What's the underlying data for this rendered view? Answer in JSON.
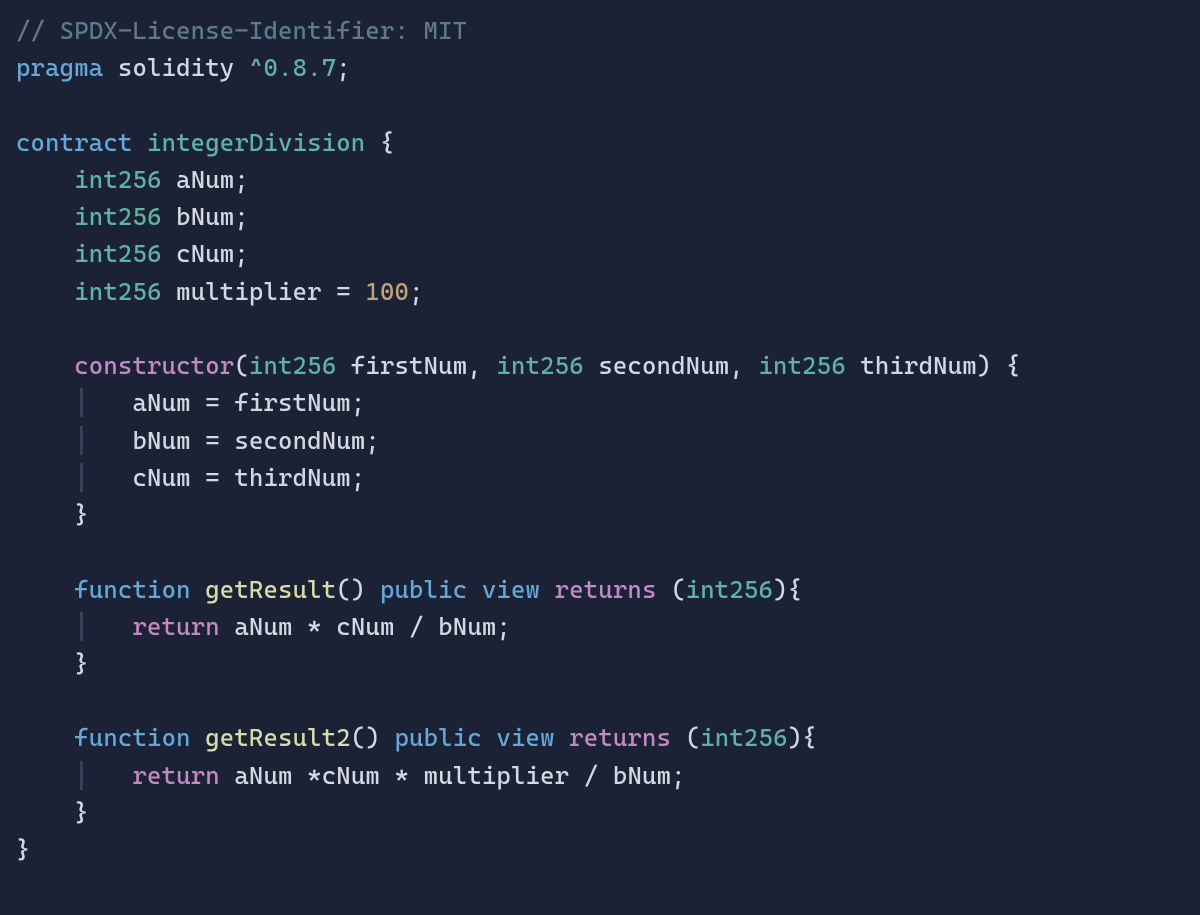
{
  "colors": {
    "background": "#1b2235",
    "comment": "#5f7a8c",
    "keyword_blue": "#64a7d8",
    "keyword_purple": "#c389c5",
    "type_teal": "#5fb3a1",
    "identifier": "#d3d8e0",
    "function_name": "#d7dba8",
    "number": "#bfa27a",
    "indent_guide": "#3a4763"
  },
  "code_lines": [
    {
      "indent": 0,
      "tokens": [
        {
          "t": "// SPDX-License-Identifier: MIT",
          "c": "comment"
        }
      ]
    },
    {
      "indent": 0,
      "tokens": [
        {
          "t": "pragma",
          "c": "keyword"
        },
        {
          "t": " ",
          "c": "punct"
        },
        {
          "t": "solidity",
          "c": "ident"
        },
        {
          "t": " ",
          "c": "punct"
        },
        {
          "t": "^0.8.7",
          "c": "type"
        },
        {
          "t": ";",
          "c": "punct"
        }
      ]
    },
    {
      "indent": 0,
      "tokens": []
    },
    {
      "indent": 0,
      "tokens": [
        {
          "t": "contract",
          "c": "keyword"
        },
        {
          "t": " ",
          "c": "punct"
        },
        {
          "t": "integerDivision",
          "c": "type"
        },
        {
          "t": " ",
          "c": "punct"
        },
        {
          "t": "{",
          "c": "punct"
        }
      ]
    },
    {
      "indent": 1,
      "tokens": [
        {
          "t": "int256",
          "c": "type"
        },
        {
          "t": " ",
          "c": "punct"
        },
        {
          "t": "aNum",
          "c": "ident"
        },
        {
          "t": ";",
          "c": "punct"
        }
      ]
    },
    {
      "indent": 1,
      "tokens": [
        {
          "t": "int256",
          "c": "type"
        },
        {
          "t": " ",
          "c": "punct"
        },
        {
          "t": "bNum",
          "c": "ident"
        },
        {
          "t": ";",
          "c": "punct"
        }
      ]
    },
    {
      "indent": 1,
      "tokens": [
        {
          "t": "int256",
          "c": "type"
        },
        {
          "t": " ",
          "c": "punct"
        },
        {
          "t": "cNum",
          "c": "ident"
        },
        {
          "t": ";",
          "c": "punct"
        }
      ]
    },
    {
      "indent": 1,
      "tokens": [
        {
          "t": "int256",
          "c": "type"
        },
        {
          "t": " ",
          "c": "punct"
        },
        {
          "t": "multiplier",
          "c": "ident"
        },
        {
          "t": " ",
          "c": "punct"
        },
        {
          "t": "=",
          "c": "punct"
        },
        {
          "t": " ",
          "c": "punct"
        },
        {
          "t": "100",
          "c": "num"
        },
        {
          "t": ";",
          "c": "punct"
        }
      ]
    },
    {
      "indent": 0,
      "tokens": []
    },
    {
      "indent": 1,
      "tokens": [
        {
          "t": "constructor",
          "c": "ctor"
        },
        {
          "t": "(",
          "c": "punct"
        },
        {
          "t": "int256",
          "c": "type"
        },
        {
          "t": " ",
          "c": "punct"
        },
        {
          "t": "firstNum",
          "c": "ident"
        },
        {
          "t": ",",
          "c": "punct"
        },
        {
          "t": " ",
          "c": "punct"
        },
        {
          "t": "int256",
          "c": "type"
        },
        {
          "t": " ",
          "c": "punct"
        },
        {
          "t": "secondNum",
          "c": "ident"
        },
        {
          "t": ",",
          "c": "punct"
        },
        {
          "t": " ",
          "c": "punct"
        },
        {
          "t": "int256",
          "c": "type"
        },
        {
          "t": " ",
          "c": "punct"
        },
        {
          "t": "thirdNum",
          "c": "ident"
        },
        {
          "t": ")",
          "c": "punct"
        },
        {
          "t": " ",
          "c": "punct"
        },
        {
          "t": "{",
          "c": "punct"
        }
      ]
    },
    {
      "indent": 2,
      "tokens": [
        {
          "t": "aNum",
          "c": "ident"
        },
        {
          "t": " ",
          "c": "punct"
        },
        {
          "t": "=",
          "c": "punct"
        },
        {
          "t": " ",
          "c": "punct"
        },
        {
          "t": "firstNum",
          "c": "ident"
        },
        {
          "t": ";",
          "c": "punct"
        }
      ]
    },
    {
      "indent": 2,
      "tokens": [
        {
          "t": "bNum",
          "c": "ident"
        },
        {
          "t": " ",
          "c": "punct"
        },
        {
          "t": "=",
          "c": "punct"
        },
        {
          "t": " ",
          "c": "punct"
        },
        {
          "t": "secondNum",
          "c": "ident"
        },
        {
          "t": ";",
          "c": "punct"
        }
      ]
    },
    {
      "indent": 2,
      "tokens": [
        {
          "t": "cNum",
          "c": "ident"
        },
        {
          "t": " ",
          "c": "punct"
        },
        {
          "t": "=",
          "c": "punct"
        },
        {
          "t": " ",
          "c": "punct"
        },
        {
          "t": "thirdNum",
          "c": "ident"
        },
        {
          "t": ";",
          "c": "punct"
        }
      ]
    },
    {
      "indent": 1,
      "tokens": [
        {
          "t": "}",
          "c": "punct"
        }
      ]
    },
    {
      "indent": 0,
      "tokens": []
    },
    {
      "indent": 1,
      "tokens": [
        {
          "t": "function",
          "c": "keyword"
        },
        {
          "t": " ",
          "c": "punct"
        },
        {
          "t": "getResult",
          "c": "func"
        },
        {
          "t": "()",
          "c": "punct"
        },
        {
          "t": " ",
          "c": "punct"
        },
        {
          "t": "public",
          "c": "keyword"
        },
        {
          "t": " ",
          "c": "punct"
        },
        {
          "t": "view",
          "c": "keyword"
        },
        {
          "t": " ",
          "c": "punct"
        },
        {
          "t": "returns",
          "c": "keyword2"
        },
        {
          "t": " ",
          "c": "punct"
        },
        {
          "t": "(",
          "c": "punct"
        },
        {
          "t": "int256",
          "c": "type"
        },
        {
          "t": ")",
          "c": "punct"
        },
        {
          "t": "{",
          "c": "punct"
        }
      ]
    },
    {
      "indent": 2,
      "tokens": [
        {
          "t": "return",
          "c": "return"
        },
        {
          "t": " ",
          "c": "punct"
        },
        {
          "t": "aNum",
          "c": "ident"
        },
        {
          "t": " ",
          "c": "punct"
        },
        {
          "t": "*",
          "c": "punct"
        },
        {
          "t": " ",
          "c": "punct"
        },
        {
          "t": "cNum",
          "c": "ident"
        },
        {
          "t": " ",
          "c": "punct"
        },
        {
          "t": "/",
          "c": "punct"
        },
        {
          "t": " ",
          "c": "punct"
        },
        {
          "t": "bNum",
          "c": "ident"
        },
        {
          "t": ";",
          "c": "punct"
        }
      ]
    },
    {
      "indent": 1,
      "tokens": [
        {
          "t": "}",
          "c": "punct"
        }
      ]
    },
    {
      "indent": 0,
      "tokens": []
    },
    {
      "indent": 1,
      "tokens": [
        {
          "t": "function",
          "c": "keyword"
        },
        {
          "t": " ",
          "c": "punct"
        },
        {
          "t": "getResult2",
          "c": "func"
        },
        {
          "t": "()",
          "c": "punct"
        },
        {
          "t": " ",
          "c": "punct"
        },
        {
          "t": "public",
          "c": "keyword"
        },
        {
          "t": " ",
          "c": "punct"
        },
        {
          "t": "view",
          "c": "keyword"
        },
        {
          "t": " ",
          "c": "punct"
        },
        {
          "t": "returns",
          "c": "keyword2"
        },
        {
          "t": " ",
          "c": "punct"
        },
        {
          "t": "(",
          "c": "punct"
        },
        {
          "t": "int256",
          "c": "type"
        },
        {
          "t": ")",
          "c": "punct"
        },
        {
          "t": "{",
          "c": "punct"
        }
      ]
    },
    {
      "indent": 2,
      "tokens": [
        {
          "t": "return",
          "c": "return"
        },
        {
          "t": " ",
          "c": "punct"
        },
        {
          "t": "aNum",
          "c": "ident"
        },
        {
          "t": " ",
          "c": "punct"
        },
        {
          "t": "*",
          "c": "punct"
        },
        {
          "t": "cNum",
          "c": "ident"
        },
        {
          "t": " ",
          "c": "punct"
        },
        {
          "t": "*",
          "c": "punct"
        },
        {
          "t": " ",
          "c": "punct"
        },
        {
          "t": "multiplier",
          "c": "ident"
        },
        {
          "t": " ",
          "c": "punct"
        },
        {
          "t": "/",
          "c": "punct"
        },
        {
          "t": " ",
          "c": "punct"
        },
        {
          "t": "bNum",
          "c": "ident"
        },
        {
          "t": ";",
          "c": "punct"
        }
      ]
    },
    {
      "indent": 1,
      "tokens": [
        {
          "t": "}",
          "c": "punct"
        }
      ]
    },
    {
      "indent": 0,
      "tokens": [
        {
          "t": "}",
          "c": "punct"
        }
      ]
    }
  ]
}
